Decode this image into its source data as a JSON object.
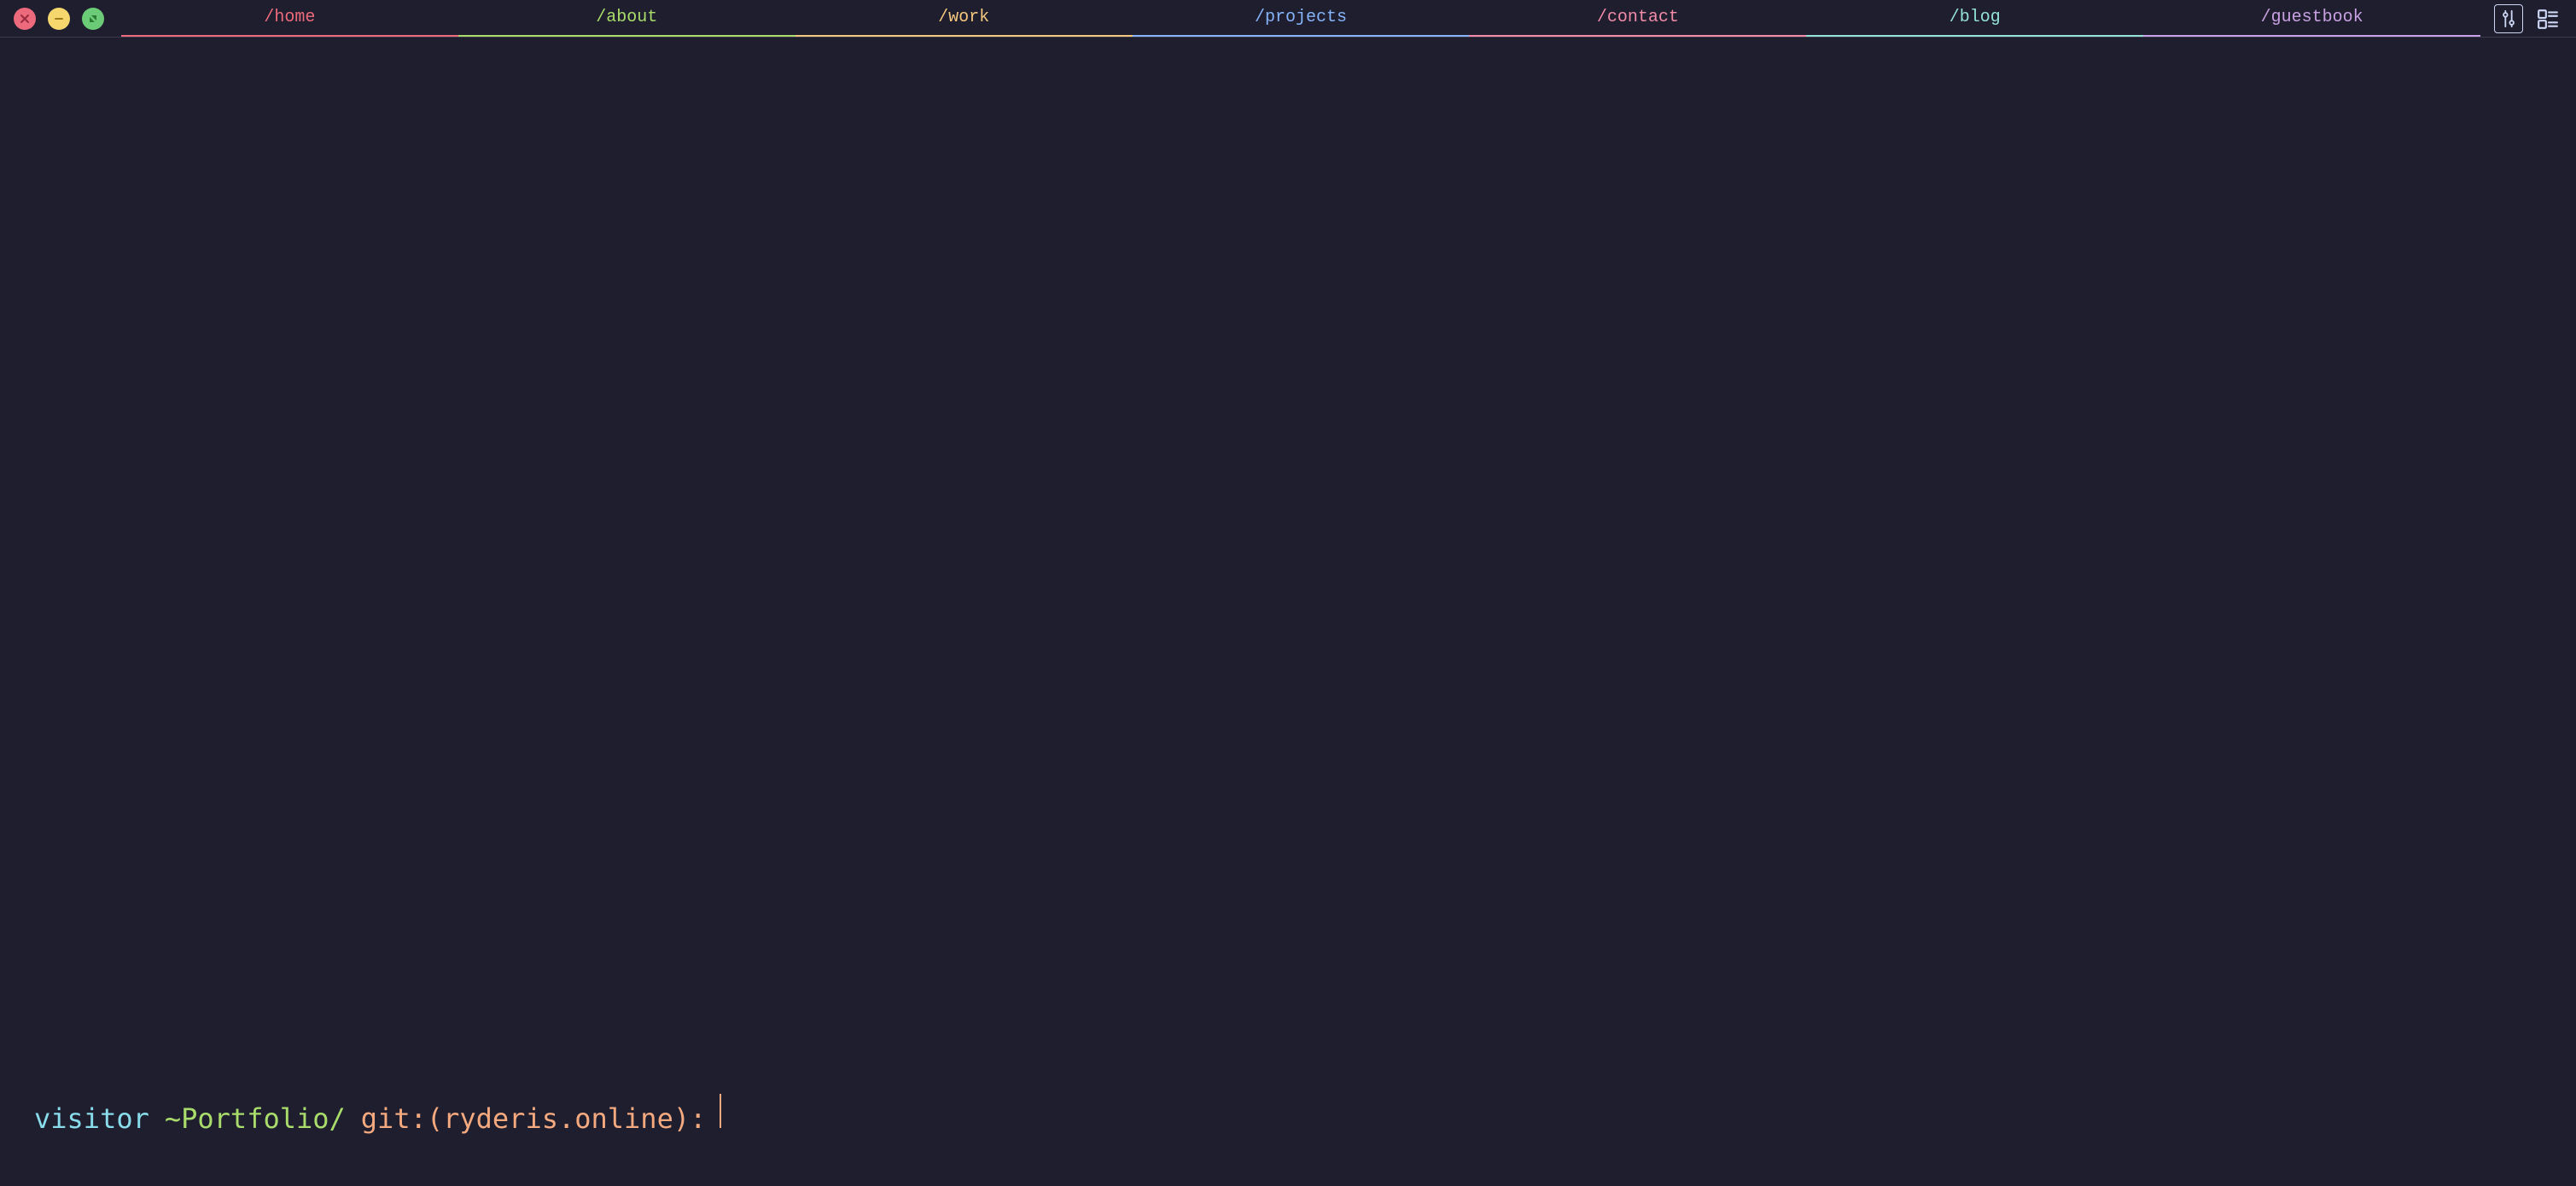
{
  "tabs": [
    {
      "label": "/home"
    },
    {
      "label": "/about"
    },
    {
      "label": "/work"
    },
    {
      "label": "/projects"
    },
    {
      "label": "/contact"
    },
    {
      "label": "/blog"
    },
    {
      "label": "/guestbook"
    }
  ],
  "prompt": {
    "user": "visitor",
    "path": "~Portfolio/",
    "git": "git:(ryderis.online):"
  }
}
